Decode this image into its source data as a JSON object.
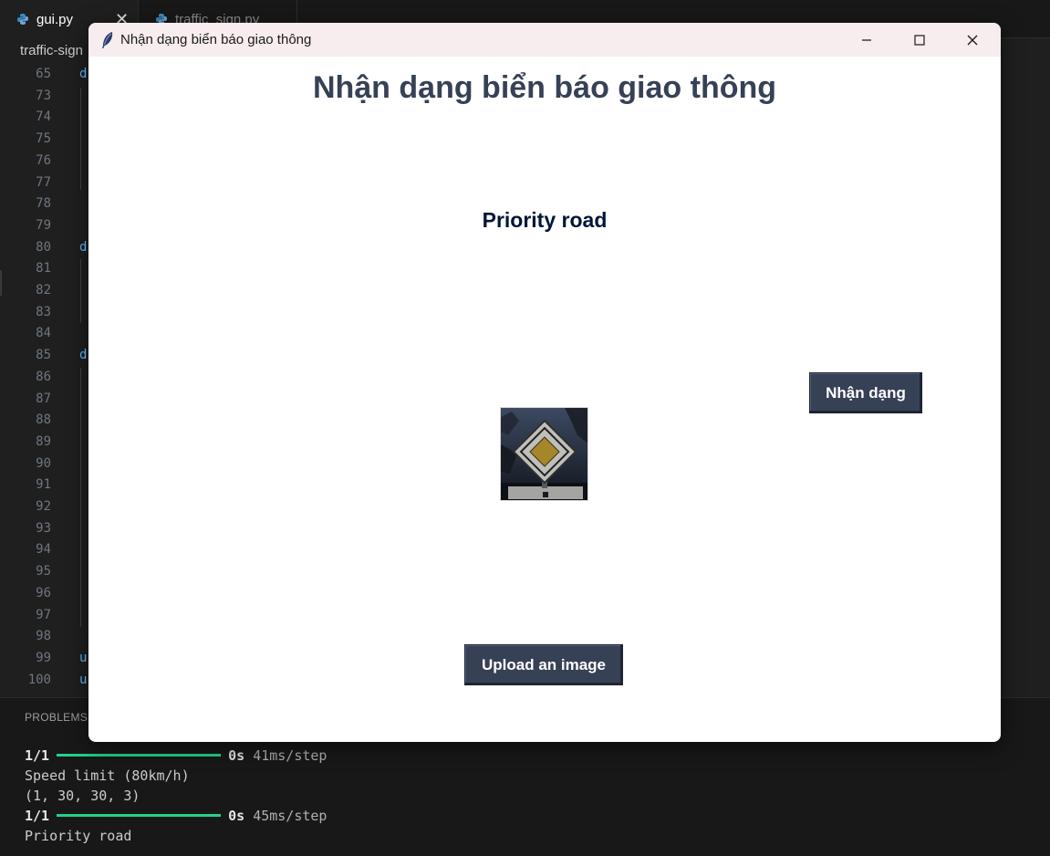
{
  "editor": {
    "tabs": [
      {
        "label": "gui.py",
        "active": true
      },
      {
        "label": "traffic_sign.py",
        "active": false
      }
    ],
    "breadcrumb": "traffic-sign",
    "line_numbers": [
      "65",
      "73",
      "74",
      "75",
      "76",
      "77",
      "78",
      "79",
      "80",
      "81",
      "82",
      "83",
      "84",
      "85",
      "86",
      "87",
      "88",
      "89",
      "90",
      "91",
      "92",
      "93",
      "94",
      "95",
      "96",
      "97",
      "98",
      "99",
      "100"
    ],
    "code_fragments": [
      {
        "line": "65",
        "text": "d"
      },
      {
        "line": "80",
        "text": "d"
      },
      {
        "line": "85",
        "text": "d"
      },
      {
        "line": "99",
        "text": "u"
      },
      {
        "line": "100",
        "text": "u"
      }
    ]
  },
  "panel": {
    "tab_label": "PROBLEMS",
    "progress": [
      {
        "count": "1/1",
        "time": "0s",
        "rate": "41ms/step",
        "fraction": 1.0
      },
      {
        "count": "1/1",
        "time": "0s",
        "rate": "45ms/step",
        "fraction": 1.0
      }
    ],
    "lines": [
      "Speed limit (80km/h)",
      "(1, 30, 30, 3)",
      "Priority road"
    ]
  },
  "app": {
    "window_title": "Nhận dạng biển báo giao thông",
    "heading": "Nhận dạng biển báo giao thông",
    "result": "Priority road",
    "classify_button": "Nhận dạng",
    "upload_button": "Upload an image"
  },
  "colors": {
    "heading": "#364156",
    "result": "#011638",
    "button_bg": "#364156",
    "progress": "#23d18b"
  }
}
